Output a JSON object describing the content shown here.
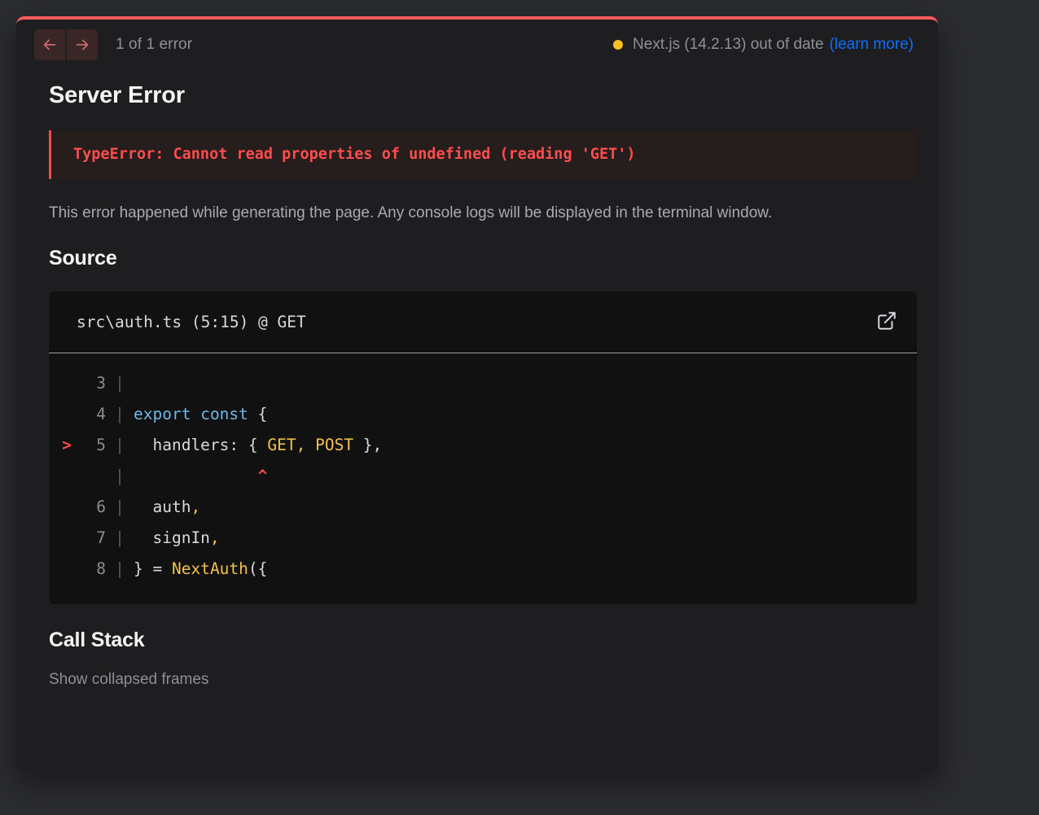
{
  "header": {
    "prev_label": "←",
    "next_label": "→",
    "error_count": "1 of 1 error",
    "version_text": "Next.js (14.2.13) out of date",
    "version_link": "(learn more)",
    "status_dot_color": "#fbbf24",
    "link_color": "#0d6efd"
  },
  "main": {
    "title": "Server Error",
    "error_message": "TypeError: Cannot read properties of undefined (reading 'GET')",
    "description": "This error happened while generating the page. Any console logs will be displayed in the terminal window.",
    "source_heading": "Source",
    "accent_color": "#ff4b4b"
  },
  "source": {
    "file": "src\\auth.ts (5:15) @ GET",
    "open_icon": "external-link-icon",
    "lines": [
      {
        "marker": "",
        "number": "3",
        "tokens": [
          {
            "t": "",
            "c": "p"
          }
        ]
      },
      {
        "marker": "",
        "number": "4",
        "tokens": [
          {
            "t": "export",
            "c": "k"
          },
          {
            "t": " ",
            "c": "p"
          },
          {
            "t": "const",
            "c": "k"
          },
          {
            "t": " ",
            "c": "p"
          },
          {
            "t": "{",
            "c": "p"
          }
        ]
      },
      {
        "marker": ">",
        "number": "5",
        "tokens": [
          {
            "t": "  handlers: { ",
            "c": "p"
          },
          {
            "t": "GET",
            "c": "y"
          },
          {
            "t": ", ",
            "c": "pc"
          },
          {
            "t": "POST",
            "c": "y"
          },
          {
            "t": " },",
            "c": "p"
          }
        ]
      },
      {
        "marker": "",
        "number": "",
        "tokens": [
          {
            "t": "             ^",
            "c": "caret"
          }
        ]
      },
      {
        "marker": "",
        "number": "6",
        "tokens": [
          {
            "t": "  auth",
            "c": "p"
          },
          {
            "t": ",",
            "c": "pc"
          }
        ]
      },
      {
        "marker": "",
        "number": "7",
        "tokens": [
          {
            "t": "  signIn",
            "c": "p"
          },
          {
            "t": ",",
            "c": "pc"
          }
        ]
      },
      {
        "marker": "",
        "number": "8",
        "tokens": [
          {
            "t": "} ",
            "c": "p"
          },
          {
            "t": "=",
            "c": "p"
          },
          {
            "t": " ",
            "c": "p"
          },
          {
            "t": "NextAuth",
            "c": "y"
          },
          {
            "t": "({",
            "c": "p"
          }
        ]
      }
    ]
  },
  "callstack": {
    "heading": "Call Stack",
    "show_collapsed": "Show collapsed frames"
  }
}
